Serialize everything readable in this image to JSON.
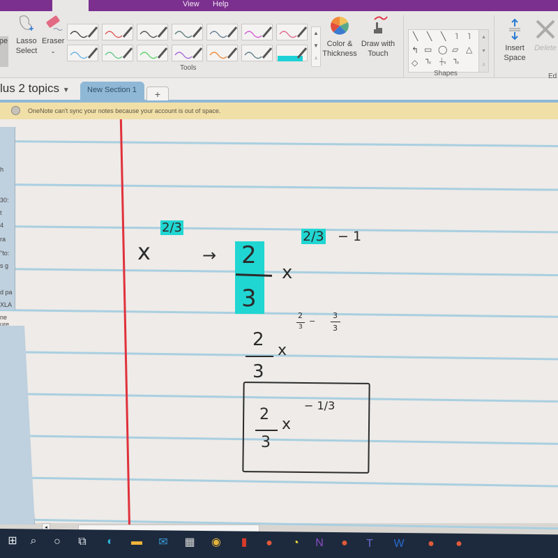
{
  "titlebar": {
    "menu_items": [
      "View",
      "Help"
    ],
    "accent_color": "#7b2f8e"
  },
  "ribbon": {
    "type_label": "pe",
    "lasso": {
      "line1": "Lasso",
      "line2": "Select",
      "icon": "lasso-icon"
    },
    "eraser": {
      "line1": "Eraser",
      "icon": "eraser-icon"
    },
    "pens": [
      {
        "color": "#444444"
      },
      {
        "color": "#e05a5a"
      },
      {
        "color": "#555555"
      },
      {
        "color": "#5f7f7f"
      },
      {
        "color": "#6b7f95"
      },
      {
        "color": "#d45ad4"
      },
      {
        "color": "#e06a8a"
      },
      {
        "color": "#6cb4e0"
      },
      {
        "color": "#66c98a"
      },
      {
        "color": "#5fd36b"
      },
      {
        "color": "#a56ad8"
      },
      {
        "color": "#f08a3a"
      },
      {
        "color": "#5f7f8a"
      },
      {
        "color": "#1fd1d6",
        "highlighter": true
      }
    ],
    "color_thickness": {
      "line1": "Color &",
      "line2": "Thickness",
      "icon": "color-wheel-icon"
    },
    "draw_with_touch": {
      "line1": "Draw with",
      "line2": "Touch",
      "icon": "touch-draw-icon"
    },
    "insert_space": {
      "line1": "Insert",
      "line2": "Space",
      "icon": "insert-space-icon"
    },
    "delete": {
      "line1": "Delete",
      "icon": "delete-icon"
    },
    "groups": {
      "tools": "Tools",
      "shapes": "Shapes",
      "edit": "Ed"
    }
  },
  "notebook": {
    "name": "lus 2 topics",
    "section_tab": "New Section 1",
    "add_tab": "+"
  },
  "banner": {
    "message": "OneNote can't sync your notes because your account is out of space.",
    "icon": "sync-error-icon"
  },
  "page_list": {
    "fragments": [
      "h",
      "30:",
      "t",
      "4",
      "ra",
      "\"to:",
      "s g",
      "d pa",
      "XLA",
      "ne ure"
    ]
  },
  "handwriting": {
    "step1": {
      "base": "x",
      "exponent": "2/3",
      "arrow": "→"
    },
    "step2": {
      "coef_num": "2",
      "coef_den": "3",
      "var": "x",
      "exponent_hl": "2/3",
      "exponent_rest": "− 1"
    },
    "step3": {
      "coef_num": "2",
      "coef_den": "3",
      "var": "x",
      "exp_a_num": "2",
      "exp_a_den": "3",
      "minus": "−",
      "exp_b_num": "3",
      "exp_b_den": "3"
    },
    "answer": {
      "coef_num": "2",
      "coef_den": "3",
      "var": "x",
      "exponent": "− 1/3"
    }
  },
  "taskbar": {
    "icons": [
      "windows-start-icon",
      "search-icon",
      "cortana-icon",
      "task-view-icon",
      "edge-icon",
      "file-explorer-icon",
      "mail-icon",
      "store-icon",
      "chrome-icon",
      "office-icon",
      "app-icon",
      "pacman-icon",
      "onenote-icon",
      "app-icon",
      "teams-icon",
      "word-icon",
      "app-icon",
      "app-icon"
    ]
  }
}
